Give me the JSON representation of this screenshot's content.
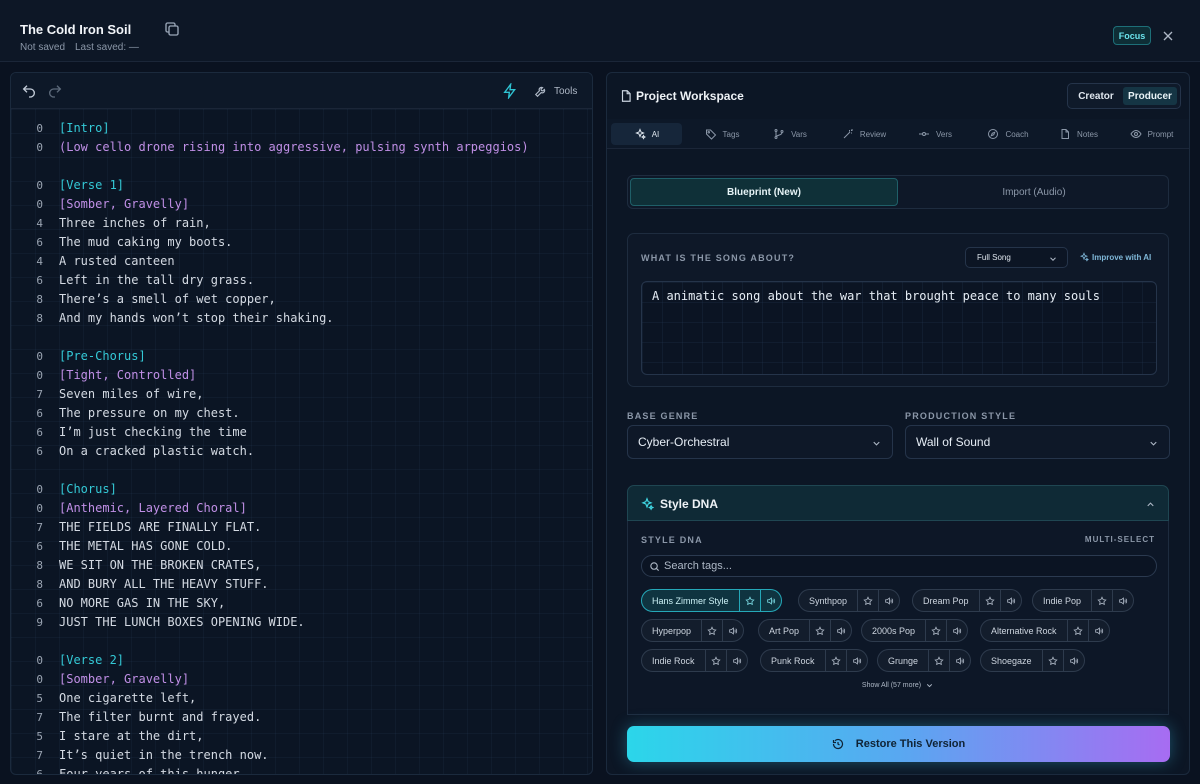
{
  "header": {
    "title": "The Cold Iron Soil",
    "save_status": "Not saved",
    "last_saved": "Last saved: —",
    "focus_label": "Focus"
  },
  "editor": {
    "tools_label": "Tools",
    "lines": [
      {
        "n": "0",
        "text": "[Intro]",
        "kind": "section"
      },
      {
        "n": "0",
        "text": "(Low cello drone rising into aggressive, pulsing synth arpeggios)",
        "kind": "direction"
      },
      {
        "n": "",
        "text": "",
        "kind": "blank"
      },
      {
        "n": "0",
        "text": "[Verse 1]",
        "kind": "section"
      },
      {
        "n": "0",
        "text": "[Somber, Gravelly]",
        "kind": "direction"
      },
      {
        "n": "4",
        "text": "Three inches of rain,",
        "kind": "lyric"
      },
      {
        "n": "6",
        "text": "The mud caking my boots.",
        "kind": "lyric"
      },
      {
        "n": "4",
        "text": "A rusted canteen",
        "kind": "lyric"
      },
      {
        "n": "6",
        "text": "Left in the tall dry grass.",
        "kind": "lyric"
      },
      {
        "n": "8",
        "text": "There’s a smell of wet copper,",
        "kind": "lyric"
      },
      {
        "n": "8",
        "text": "And my hands won’t stop their shaking.",
        "kind": "lyric"
      },
      {
        "n": "",
        "text": "",
        "kind": "blank"
      },
      {
        "n": "0",
        "text": "[Pre-Chorus]",
        "kind": "section"
      },
      {
        "n": "0",
        "text": "[Tight, Controlled]",
        "kind": "direction"
      },
      {
        "n": "7",
        "text": "Seven miles of wire,",
        "kind": "lyric"
      },
      {
        "n": "6",
        "text": "The pressure on my chest.",
        "kind": "lyric"
      },
      {
        "n": "6",
        "text": "I’m just checking the time",
        "kind": "lyric"
      },
      {
        "n": "6",
        "text": "On a cracked plastic watch.",
        "kind": "lyric"
      },
      {
        "n": "",
        "text": "",
        "kind": "blank"
      },
      {
        "n": "0",
        "text": "[Chorus]",
        "kind": "section"
      },
      {
        "n": "0",
        "text": "[Anthemic, Layered Choral]",
        "kind": "direction"
      },
      {
        "n": "7",
        "text": "THE FIELDS ARE FINALLY FLAT.",
        "kind": "lyric"
      },
      {
        "n": "6",
        "text": "THE METAL HAS GONE COLD.",
        "kind": "lyric"
      },
      {
        "n": "8",
        "text": "WE SIT ON THE BROKEN CRATES,",
        "kind": "lyric"
      },
      {
        "n": "8",
        "text": "AND BURY ALL THE HEAVY STUFF.",
        "kind": "lyric"
      },
      {
        "n": "6",
        "text": "NO MORE GAS IN THE SKY,",
        "kind": "lyric"
      },
      {
        "n": "9",
        "text": "JUST THE LUNCH BOXES OPENING WIDE.",
        "kind": "lyric"
      },
      {
        "n": "",
        "text": "",
        "kind": "blank"
      },
      {
        "n": "0",
        "text": "[Verse 2]",
        "kind": "section"
      },
      {
        "n": "0",
        "text": "[Somber, Gravelly]",
        "kind": "direction"
      },
      {
        "n": "5",
        "text": "One cigarette left,",
        "kind": "lyric"
      },
      {
        "n": "7",
        "text": "The filter burnt and frayed.",
        "kind": "lyric"
      },
      {
        "n": "5",
        "text": "I stare at the dirt,",
        "kind": "lyric"
      },
      {
        "n": "7",
        "text": "It’s quiet in the trench now.",
        "kind": "lyric"
      },
      {
        "n": "6",
        "text": "Four years of this hunger",
        "kind": "lyric"
      }
    ]
  },
  "workspace": {
    "title": "Project Workspace",
    "mode_creator": "Creator",
    "mode_producer": "Producer",
    "tabs": [
      {
        "label": "AI",
        "icon": "sparkle-icon"
      },
      {
        "label": "Tags",
        "icon": "tag-icon"
      },
      {
        "label": "Vars",
        "icon": "branch-icon"
      },
      {
        "label": "Review",
        "icon": "wand-icon"
      },
      {
        "label": "Vers",
        "icon": "commit-icon"
      },
      {
        "label": "Coach",
        "icon": "compass-icon"
      },
      {
        "label": "Notes",
        "icon": "note-icon"
      },
      {
        "label": "Prompt",
        "icon": "eye-icon"
      }
    ],
    "blueprint_new": "Blueprint (New)",
    "import_audio": "Import (Audio)",
    "about_label": "WHAT IS THE SONG ABOUT?",
    "scope_value": "Full Song",
    "improve_label": "Improve with AI",
    "about_text": "A animatic song about the war that brought peace to many souls",
    "base_genre_label": "BASE GENRE",
    "base_genre_value": "Cyber-Orchestral",
    "production_style_label": "PRODUCTION STYLE",
    "production_style_value": "Wall of Sound",
    "style_dna_title": "Style DNA",
    "style_dna_label": "STYLE DNA",
    "multi_select_label": "MULTI-SELECT",
    "search_placeholder": "Search tags...",
    "tags": [
      {
        "name": "Hans Zimmer Style",
        "selected": true
      },
      {
        "name": "Synthpop",
        "selected": false
      },
      {
        "name": "Dream Pop",
        "selected": false
      },
      {
        "name": "Indie Pop",
        "selected": false
      },
      {
        "name": "Hyperpop",
        "selected": false
      },
      {
        "name": "Art Pop",
        "selected": false
      },
      {
        "name": "2000s Pop",
        "selected": false
      },
      {
        "name": "Alternative Rock",
        "selected": false
      },
      {
        "name": "Indie Rock",
        "selected": false
      },
      {
        "name": "Punk Rock",
        "selected": false
      },
      {
        "name": "Grunge",
        "selected": false
      },
      {
        "name": "Shoegaze",
        "selected": false
      }
    ],
    "show_all_label": "Show All (57 more)",
    "restore_label": "Restore This Version"
  },
  "colors": {
    "accent_cyan": "#34c9d6",
    "accent_purple": "#c08fe6",
    "background": "#0a1220"
  }
}
